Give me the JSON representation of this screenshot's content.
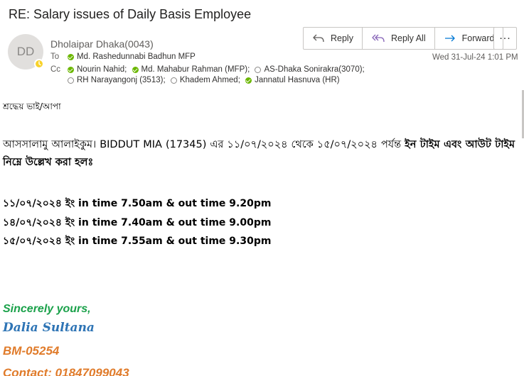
{
  "email": {
    "subject": "RE: Salary issues of Daily Basis Employee",
    "avatar_initials": "DD",
    "sender": "Dholaipar Dhaka(0043)",
    "to_label": "To",
    "cc_label": "Cc",
    "to": [
      {
        "name": "Md. Rashedunnabi Badhun MFP",
        "status": "available"
      }
    ],
    "cc_line1": [
      {
        "name": "Nourin Nahid;",
        "status": "available"
      },
      {
        "name": "Md. Mahabur Rahman (MFP);",
        "status": "available"
      },
      {
        "name": "AS-Dhaka Sonirakra(3070);",
        "status": "offline"
      }
    ],
    "cc_line2": [
      {
        "name": "RH Narayangonj (3513);",
        "status": "offline"
      },
      {
        "name": "Khadem Ahmed;",
        "status": "offline"
      },
      {
        "name": "Jannatul Hasnuva (HR)",
        "status": "available"
      }
    ],
    "date": "Wed 31-Jul-24 1:01 PM"
  },
  "actions": {
    "reply": "Reply",
    "reply_all": "Reply All",
    "forward": "Forward",
    "more": "..."
  },
  "body": {
    "greeting": "শ্রদ্ধেয় ভাই/আপা",
    "para_intro": "আসসালামু আলাইকুম। BIDDUT MIA (17345) এর ১১/০৭/২০২৪ থেকে ১৫/০৭/২০২৪ পর্যন্ত ",
    "para_bold": "ইন টাইম এবং আউট টাইম  নিম্নে উল্লেখ করা হলঃ",
    "times": [
      "১১/০৭/২০২৪ ইং in time 7.50am & out time 9.20pm",
      "১৪/০৭/২০২৪ ইং in time 7.40am & out time 9.00pm",
      "১৫/০৭/২০২৪ ইং in time 7.55am & out time 9.30pm"
    ]
  },
  "signature": {
    "closing": "Sincerely yours,",
    "name": "Dalia Sultana",
    "id": "BM-05254",
    "contact": "Contact: 01847099043"
  },
  "colors": {
    "available": "#6bb700",
    "presence_away": "#f8d22a",
    "sig_green": "#1aa14a",
    "sig_blue": "#2e74b5",
    "sig_orange": "#e07b2a"
  }
}
